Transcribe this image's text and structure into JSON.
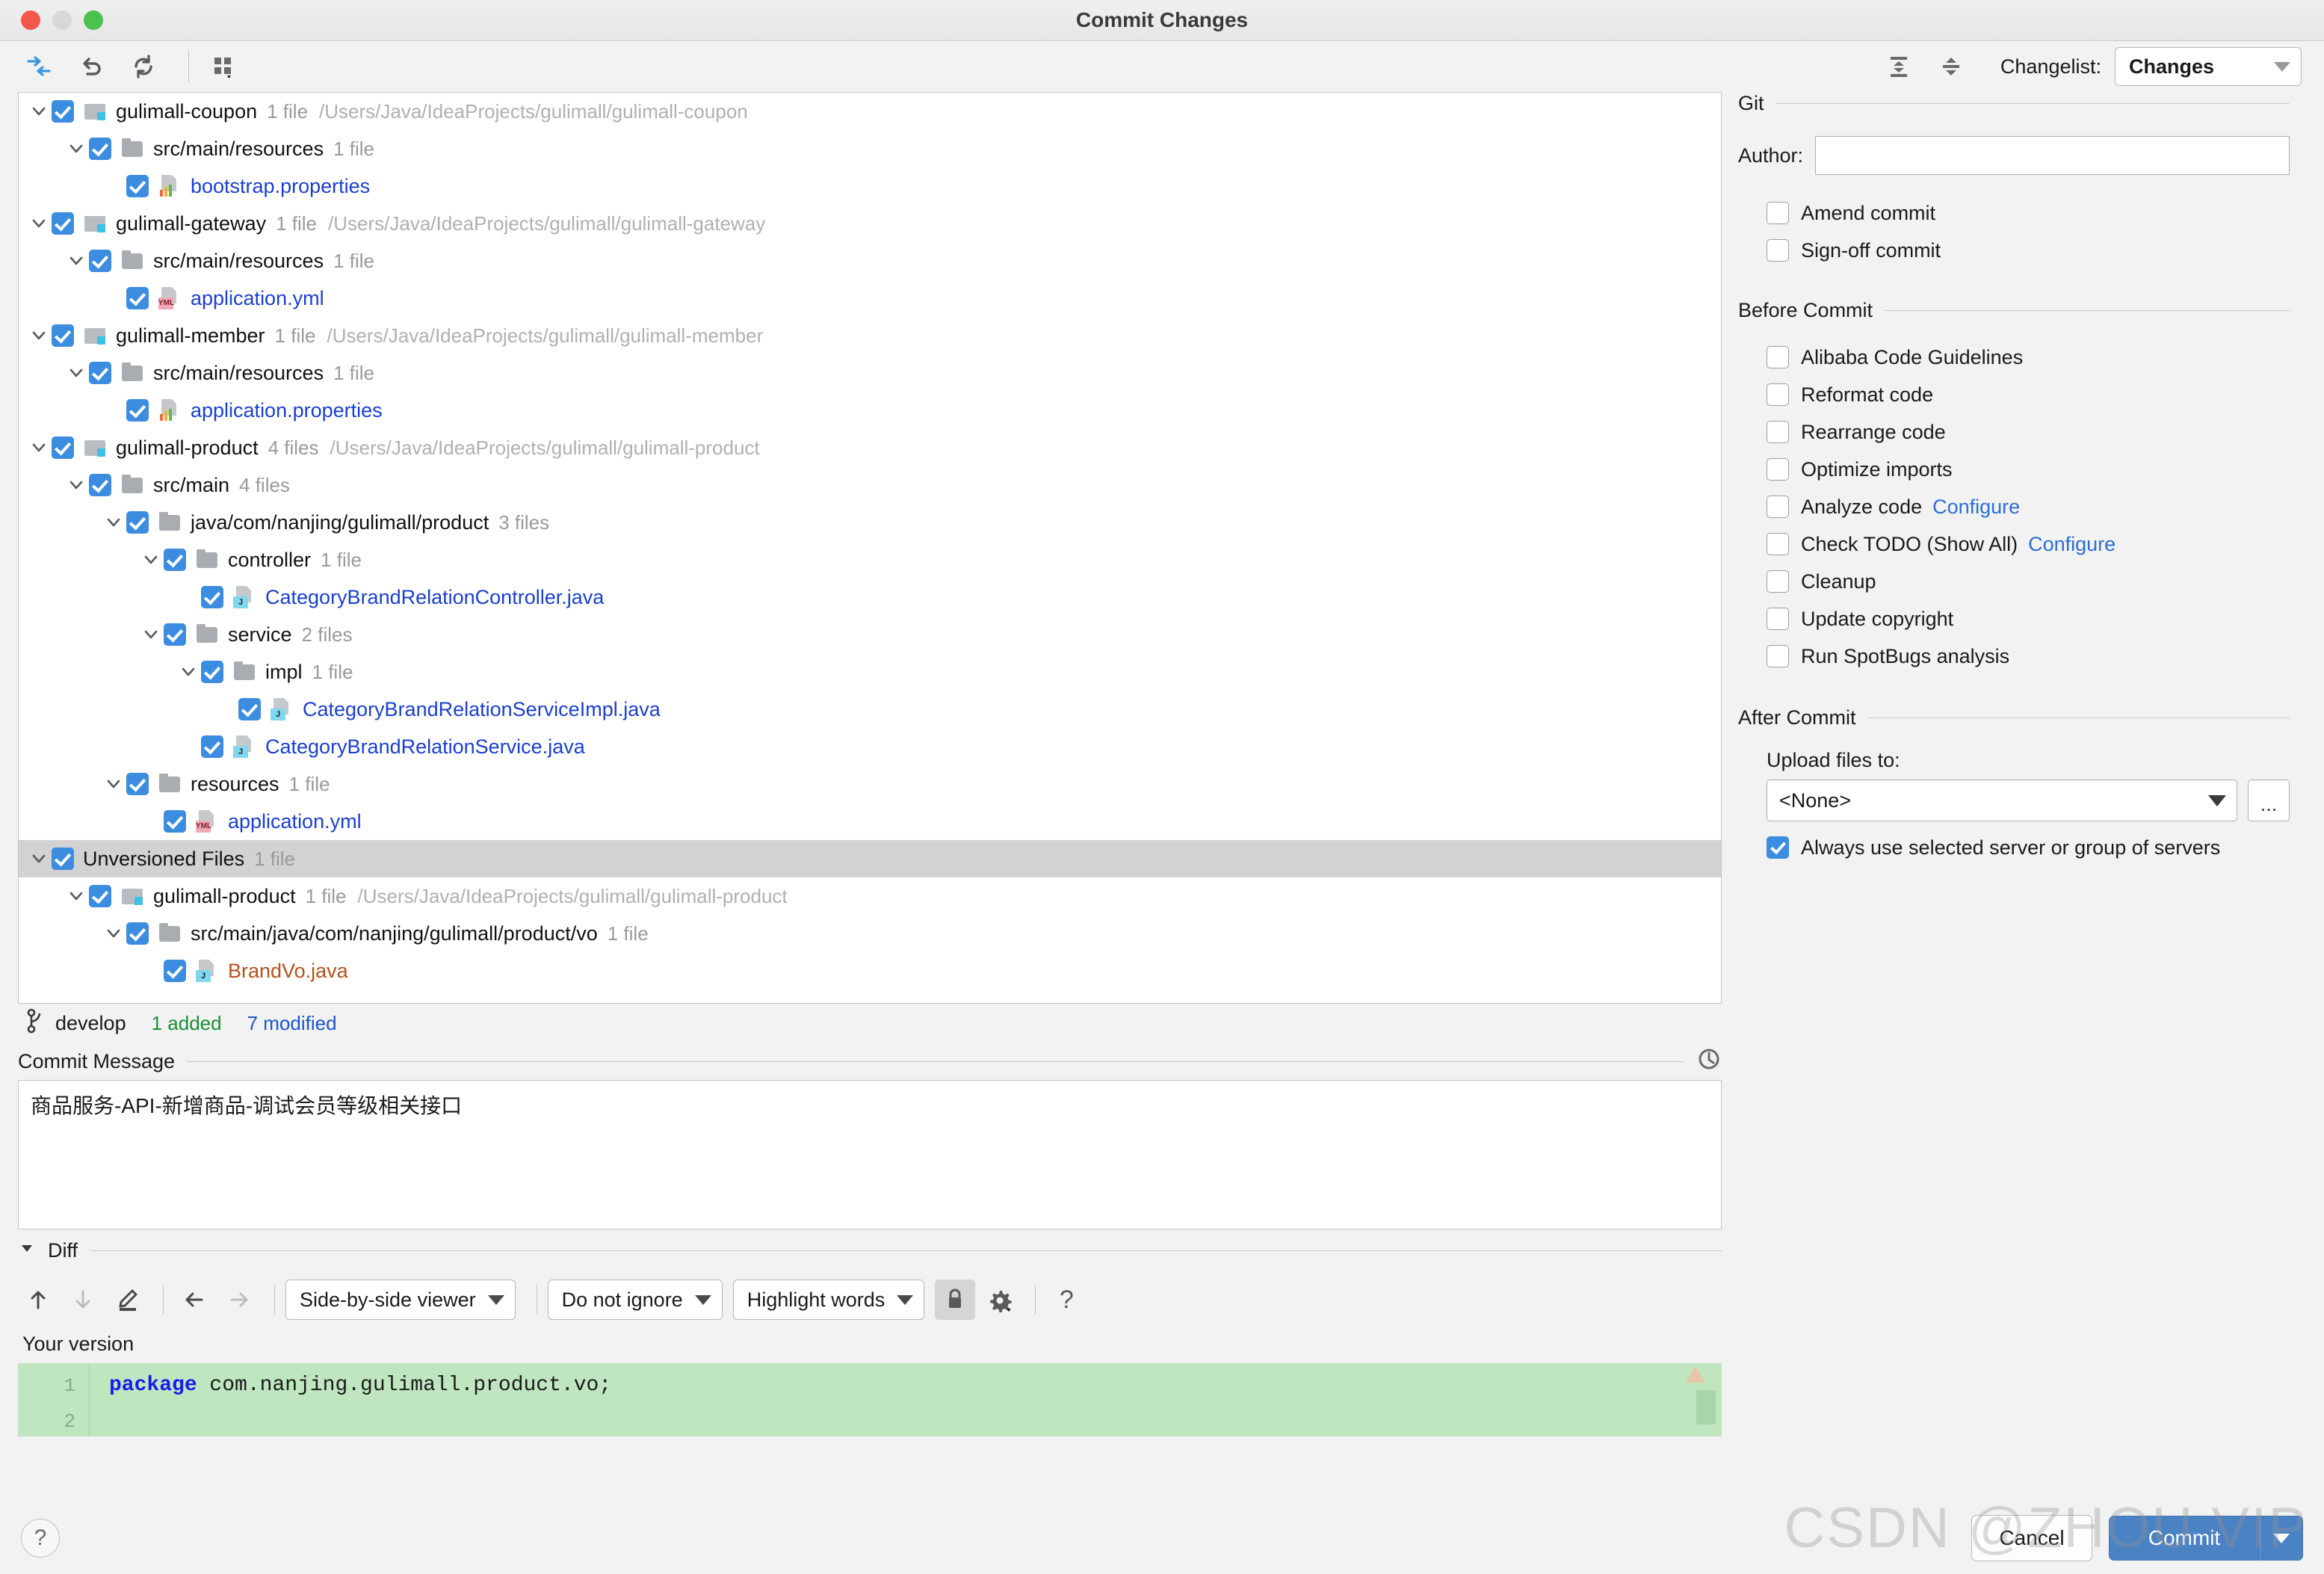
{
  "window": {
    "title": "Commit Changes"
  },
  "toolbar": {
    "icons": [
      "collapse-inward-icon",
      "revert-icon",
      "refresh-icon",
      "group-by-icon"
    ],
    "expand_all_label": "expand-all-icon",
    "collapse_all_label": "collapse-all-icon",
    "changelist_label": "Changelist:",
    "changelist_value": "Changes"
  },
  "tree": [
    {
      "indent": 0,
      "twisty": "down",
      "checked": true,
      "icon": "module",
      "name": "gulimall-coupon",
      "count": "1 file",
      "path": "/Users/Java/IdeaProjects/gulimall/gulimall-coupon",
      "style": "plain"
    },
    {
      "indent": 1,
      "twisty": "down",
      "checked": true,
      "icon": "folder",
      "name": "src/main/resources",
      "count": "1 file",
      "path": "",
      "style": "plain"
    },
    {
      "indent": 2,
      "twisty": "none",
      "checked": true,
      "icon": "properties",
      "name": "bootstrap.properties",
      "count": "",
      "path": "",
      "style": "modified"
    },
    {
      "indent": 0,
      "twisty": "down",
      "checked": true,
      "icon": "module",
      "name": "gulimall-gateway",
      "count": "1 file",
      "path": "/Users/Java/IdeaProjects/gulimall/gulimall-gateway",
      "style": "plain"
    },
    {
      "indent": 1,
      "twisty": "down",
      "checked": true,
      "icon": "folder",
      "name": "src/main/resources",
      "count": "1 file",
      "path": "",
      "style": "plain"
    },
    {
      "indent": 2,
      "twisty": "none",
      "checked": true,
      "icon": "yml",
      "name": "application.yml",
      "count": "",
      "path": "",
      "style": "modified"
    },
    {
      "indent": 0,
      "twisty": "down",
      "checked": true,
      "icon": "module",
      "name": "gulimall-member",
      "count": "1 file",
      "path": "/Users/Java/IdeaProjects/gulimall/gulimall-member",
      "style": "plain"
    },
    {
      "indent": 1,
      "twisty": "down",
      "checked": true,
      "icon": "folder",
      "name": "src/main/resources",
      "count": "1 file",
      "path": "",
      "style": "plain"
    },
    {
      "indent": 2,
      "twisty": "none",
      "checked": true,
      "icon": "properties",
      "name": "application.properties",
      "count": "",
      "path": "",
      "style": "modified"
    },
    {
      "indent": 0,
      "twisty": "down",
      "checked": true,
      "icon": "module",
      "name": "gulimall-product",
      "count": "4 files",
      "path": "/Users/Java/IdeaProjects/gulimall/gulimall-product",
      "style": "plain"
    },
    {
      "indent": 1,
      "twisty": "down",
      "checked": true,
      "icon": "folder",
      "name": "src/main",
      "count": "4 files",
      "path": "",
      "style": "plain"
    },
    {
      "indent": 2,
      "twisty": "down",
      "checked": true,
      "icon": "folder",
      "name": "java/com/nanjing/gulimall/product",
      "count": "3 files",
      "path": "",
      "style": "plain"
    },
    {
      "indent": 3,
      "twisty": "down",
      "checked": true,
      "icon": "folder",
      "name": "controller",
      "count": "1 file",
      "path": "",
      "style": "plain"
    },
    {
      "indent": 4,
      "twisty": "none",
      "checked": true,
      "icon": "java",
      "name": "CategoryBrandRelationController.java",
      "count": "",
      "path": "",
      "style": "modified"
    },
    {
      "indent": 3,
      "twisty": "down",
      "checked": true,
      "icon": "folder",
      "name": "service",
      "count": "2 files",
      "path": "",
      "style": "plain"
    },
    {
      "indent": 4,
      "twisty": "down",
      "checked": true,
      "icon": "folder",
      "name": "impl",
      "count": "1 file",
      "path": "",
      "style": "plain"
    },
    {
      "indent": 5,
      "twisty": "none",
      "checked": true,
      "icon": "java",
      "name": "CategoryBrandRelationServiceImpl.java",
      "count": "",
      "path": "",
      "style": "modified"
    },
    {
      "indent": 4,
      "twisty": "none",
      "checked": true,
      "icon": "java",
      "name": "CategoryBrandRelationService.java",
      "count": "",
      "path": "",
      "style": "modified"
    },
    {
      "indent": 2,
      "twisty": "down",
      "checked": true,
      "icon": "folder",
      "name": "resources",
      "count": "1 file",
      "path": "",
      "style": "plain"
    },
    {
      "indent": 3,
      "twisty": "none",
      "checked": true,
      "icon": "yml",
      "name": "application.yml",
      "count": "",
      "path": "",
      "style": "modified"
    },
    {
      "indent": 0,
      "twisty": "down",
      "checked": true,
      "icon": "none",
      "name": "Unversioned Files",
      "count": "1 file",
      "path": "",
      "style": "section"
    },
    {
      "indent": 1,
      "twisty": "down",
      "checked": true,
      "icon": "module",
      "name": "gulimall-product",
      "count": "1 file",
      "path": "/Users/Java/IdeaProjects/gulimall/gulimall-product",
      "style": "plain"
    },
    {
      "indent": 2,
      "twisty": "down",
      "checked": true,
      "icon": "folder",
      "name": "src/main/java/com/nanjing/gulimall/product/vo",
      "count": "1 file",
      "path": "",
      "style": "plain"
    },
    {
      "indent": 3,
      "twisty": "none",
      "checked": true,
      "icon": "java",
      "name": "BrandVo.java",
      "count": "",
      "path": "",
      "style": "unversioned"
    }
  ],
  "status_bar": {
    "branch": "develop",
    "added": "1 added",
    "modified": "7 modified"
  },
  "commit_message": {
    "label": "Commit Message",
    "value": "商品服务-API-新增商品-调试会员等级相关接口",
    "history_icon": "clock-icon"
  },
  "diff": {
    "section_label": "Diff",
    "viewer_mode": "Side-by-side viewer",
    "ignore_mode": "Do not ignore",
    "highlight_mode": "Highlight words",
    "your_version_label": "Your version",
    "lines": [
      {
        "no": "1",
        "keyword": "package",
        "rest": " com.nanjing.gulimall.product.vo;"
      },
      {
        "no": "2",
        "keyword": "",
        "rest": ""
      }
    ]
  },
  "git": {
    "section_label": "Git",
    "author_label": "Author:",
    "author_value": "",
    "checkboxes": [
      {
        "label": "Amend commit",
        "checked": false
      },
      {
        "label": "Sign-off commit",
        "checked": false
      }
    ]
  },
  "before_commit": {
    "section_label": "Before Commit",
    "checkboxes": [
      {
        "label": "Alibaba Code Guidelines",
        "checked": false,
        "link": ""
      },
      {
        "label": "Reformat code",
        "checked": false,
        "link": ""
      },
      {
        "label": "Rearrange code",
        "checked": false,
        "link": ""
      },
      {
        "label": "Optimize imports",
        "checked": false,
        "link": ""
      },
      {
        "label": "Analyze code",
        "checked": false,
        "link": "Configure"
      },
      {
        "label": "Check TODO (Show All)",
        "checked": false,
        "link": "Configure"
      },
      {
        "label": "Cleanup",
        "checked": false,
        "link": ""
      },
      {
        "label": "Update copyright",
        "checked": false,
        "link": ""
      },
      {
        "label": "Run SpotBugs analysis",
        "checked": false,
        "link": ""
      }
    ]
  },
  "after_commit": {
    "section_label": "After Commit",
    "upload_label": "Upload files to:",
    "upload_value": "<None>",
    "browse_label": "...",
    "always_use_label": "Always use selected server or group of servers",
    "always_use_checked": true
  },
  "footer": {
    "help_label": "?",
    "cancel_label": "Cancel",
    "commit_label": "Commit"
  },
  "watermark": "CSDN @ZHOU VIP"
}
